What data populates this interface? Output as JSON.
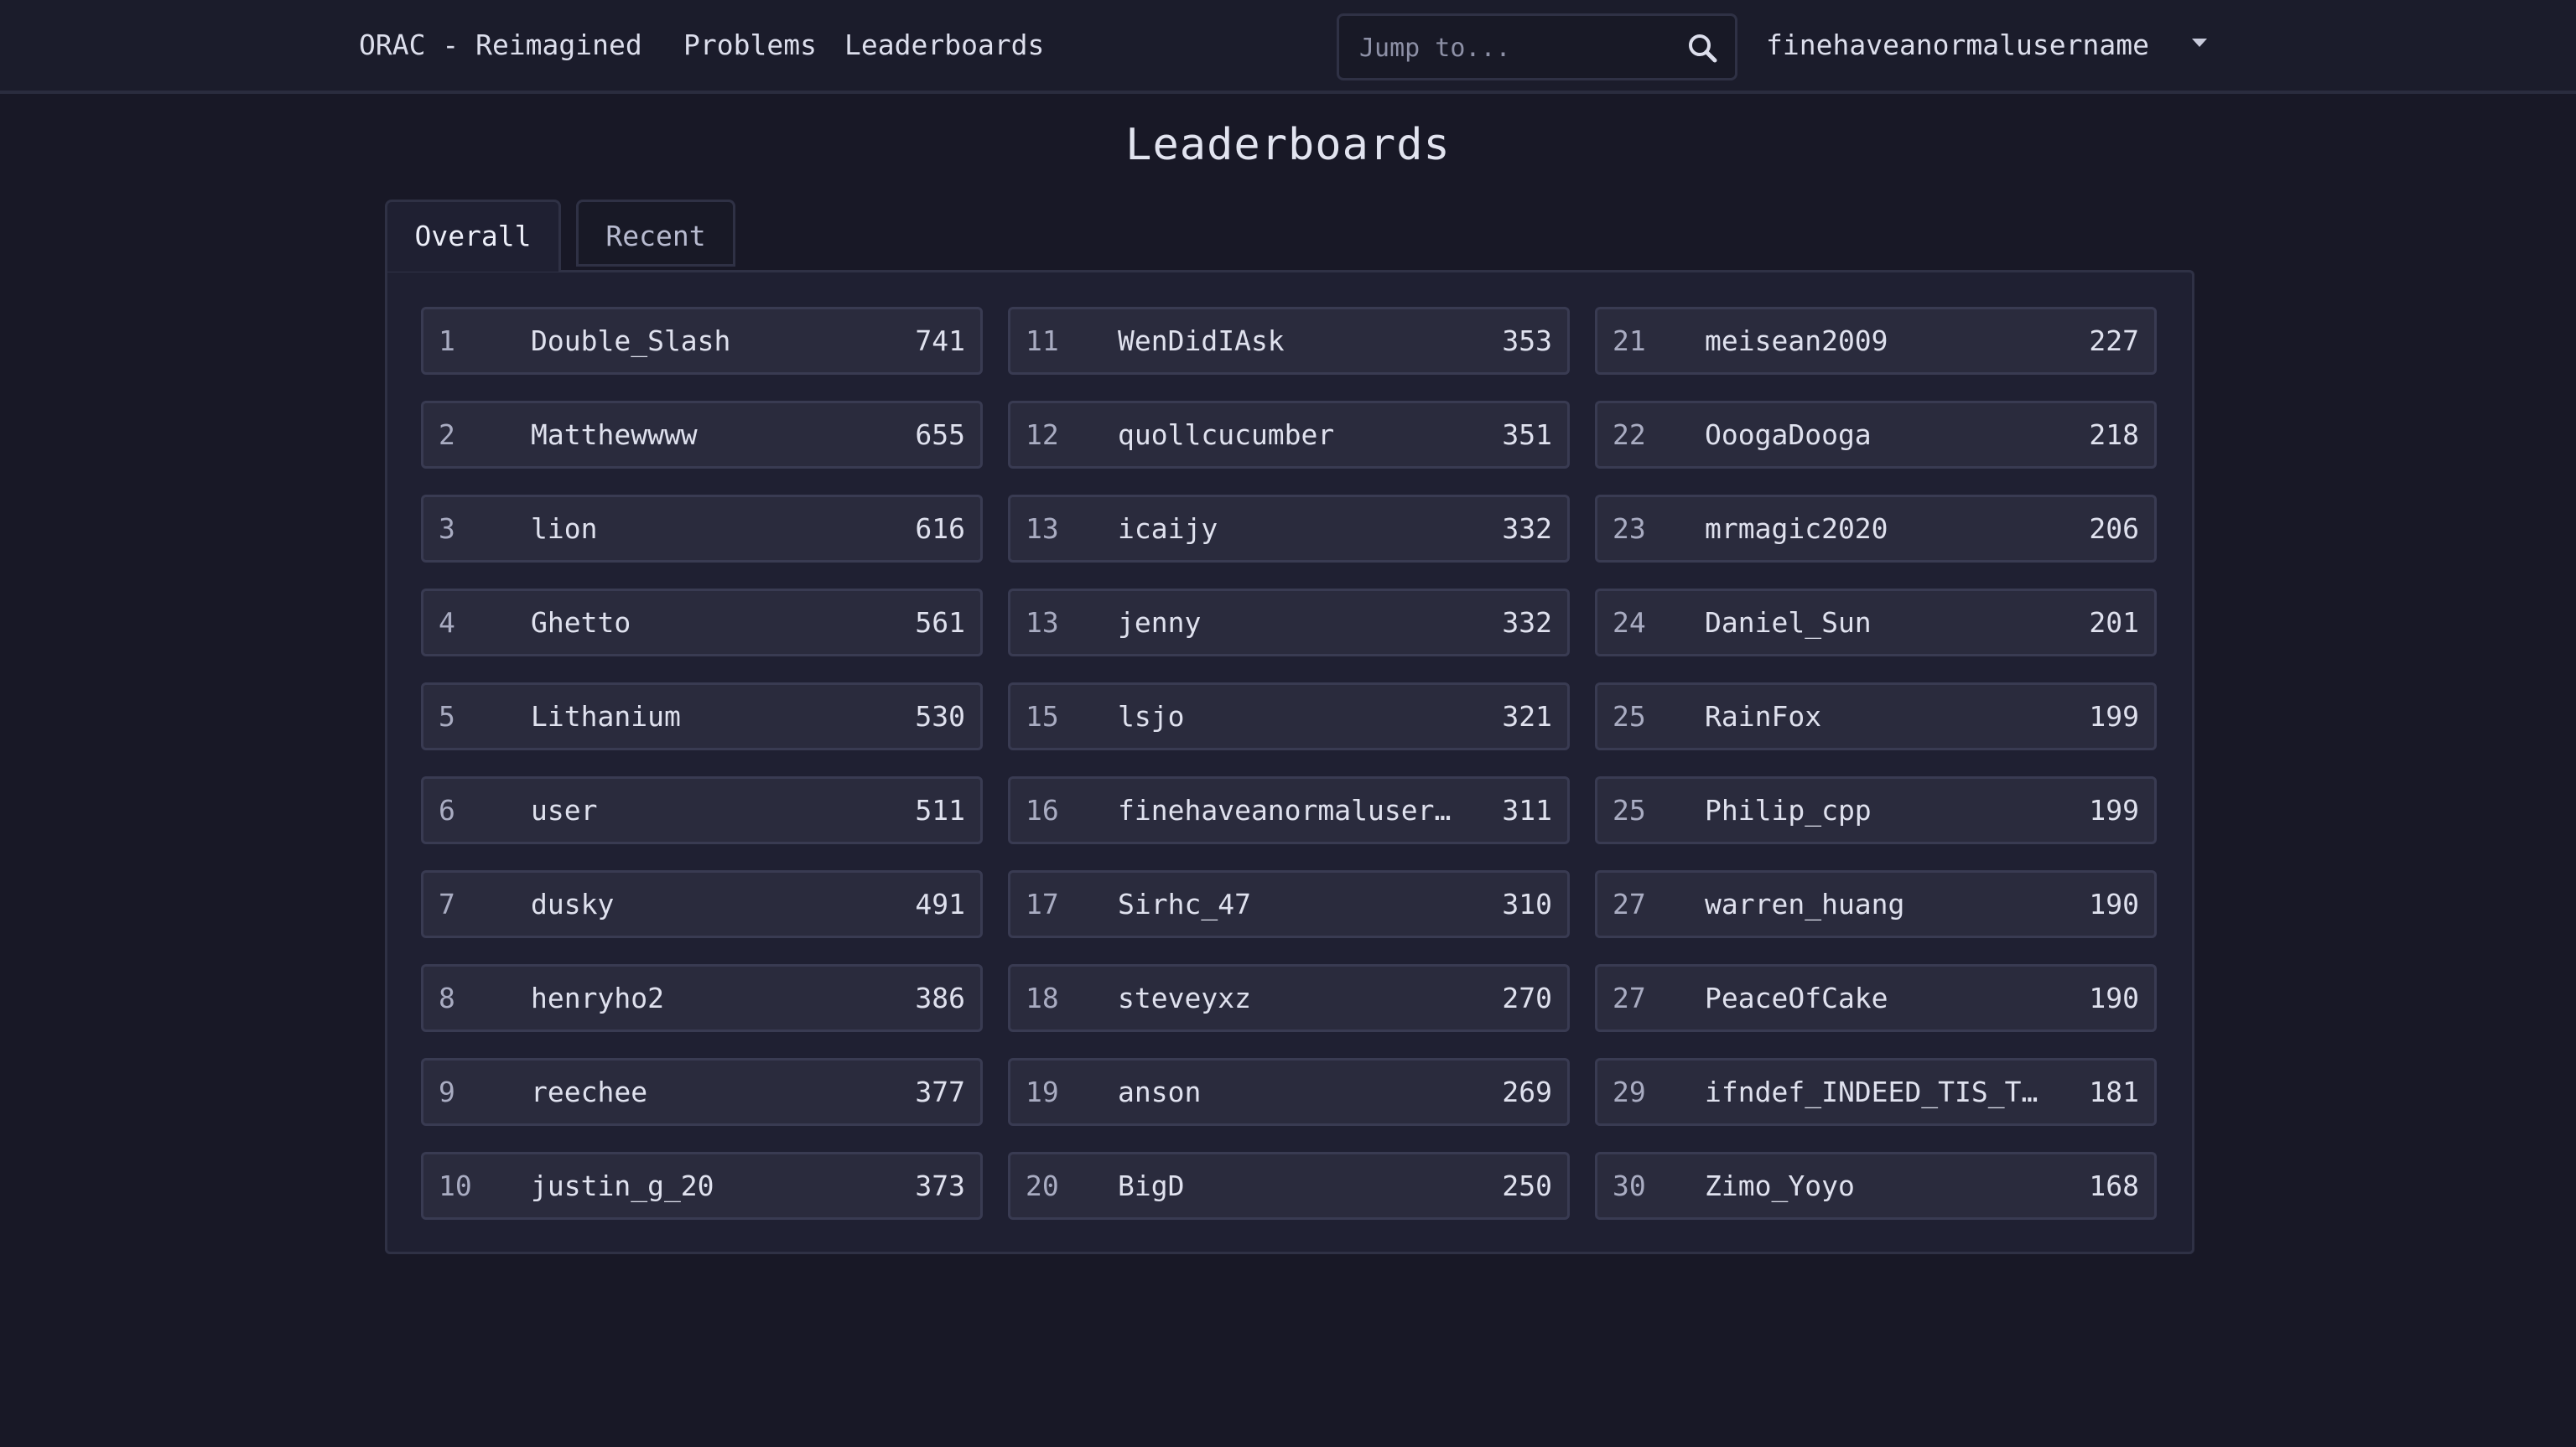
{
  "nav": {
    "brand": "ORAC - Reimagined",
    "problems": "Problems",
    "leaderboards": "Leaderboards",
    "search_placeholder": "Jump to...",
    "username": "finehaveanormalusername"
  },
  "page": {
    "title": "Leaderboards"
  },
  "tabs": [
    {
      "label": "Overall",
      "active": true
    },
    {
      "label": "Recent",
      "active": false
    }
  ],
  "leaderboard": [
    {
      "rank": "1",
      "name": "Double_Slash",
      "score": "741"
    },
    {
      "rank": "2",
      "name": "Matthewwww",
      "score": "655"
    },
    {
      "rank": "3",
      "name": "lion",
      "score": "616"
    },
    {
      "rank": "4",
      "name": "Ghetto",
      "score": "561"
    },
    {
      "rank": "5",
      "name": "Lithanium",
      "score": "530"
    },
    {
      "rank": "6",
      "name": "user",
      "score": "511"
    },
    {
      "rank": "7",
      "name": "dusky",
      "score": "491"
    },
    {
      "rank": "8",
      "name": "henryho2",
      "score": "386"
    },
    {
      "rank": "9",
      "name": "reechee",
      "score": "377"
    },
    {
      "rank": "10",
      "name": "justin_g_20",
      "score": "373"
    },
    {
      "rank": "11",
      "name": "WenDidIAsk",
      "score": "353"
    },
    {
      "rank": "12",
      "name": "quollcucumber",
      "score": "351"
    },
    {
      "rank": "13",
      "name": "icaijy",
      "score": "332"
    },
    {
      "rank": "13",
      "name": "jenny",
      "score": "332"
    },
    {
      "rank": "15",
      "name": "lsjo",
      "score": "321"
    },
    {
      "rank": "16",
      "name": "finehaveanormaluser…",
      "score": "311"
    },
    {
      "rank": "17",
      "name": "Sirhc_47",
      "score": "310"
    },
    {
      "rank": "18",
      "name": "steveyxz",
      "score": "270"
    },
    {
      "rank": "19",
      "name": "anson",
      "score": "269"
    },
    {
      "rank": "20",
      "name": "BigD",
      "score": "250"
    },
    {
      "rank": "21",
      "name": "meisean2009",
      "score": "227"
    },
    {
      "rank": "22",
      "name": "OoogaDooga",
      "score": "218"
    },
    {
      "rank": "23",
      "name": "mrmagic2020",
      "score": "206"
    },
    {
      "rank": "24",
      "name": "Daniel_Sun",
      "score": "201"
    },
    {
      "rank": "25",
      "name": "RainFox",
      "score": "199"
    },
    {
      "rank": "25",
      "name": "Philip_cpp",
      "score": "199"
    },
    {
      "rank": "27",
      "name": "warren_huang",
      "score": "190"
    },
    {
      "rank": "27",
      "name": "PeaceOfCake",
      "score": "190"
    },
    {
      "rank": "29",
      "name": "ifndef_INDEED_TIS_T…",
      "score": "181"
    },
    {
      "rank": "30",
      "name": "Zimo_Yoyo",
      "score": "168"
    }
  ]
}
